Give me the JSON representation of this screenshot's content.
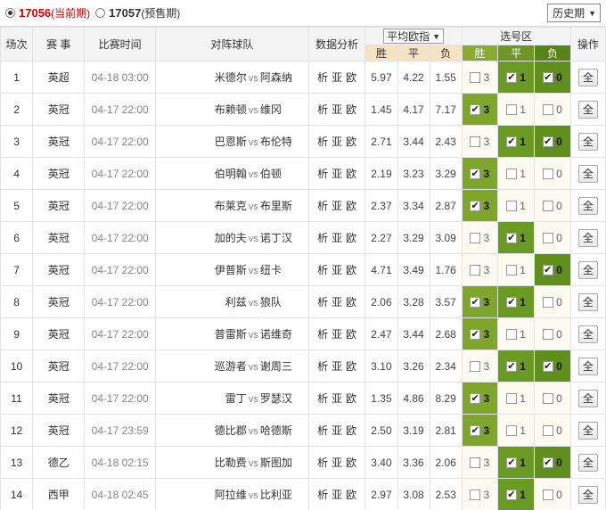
{
  "topbar": {
    "current": {
      "num": "17056",
      "note": "(当前期)"
    },
    "presale": {
      "num": "17057",
      "note": "(预售期)"
    },
    "history_label": "历史期"
  },
  "header": {
    "col_idx": "场次",
    "col_league": "赛 事",
    "col_time": "比赛时间",
    "col_teams": "对阵球队",
    "col_analysis": "数据分析",
    "odds_select": "平均欧指",
    "odds_w": "胜",
    "odds_d": "平",
    "odds_l": "负",
    "select_area": "选号区",
    "sel_w": "胜",
    "sel_d": "平",
    "sel_l": "负",
    "col_op": "操作"
  },
  "analysis_links": [
    "析",
    "亚",
    "欧"
  ],
  "vs": "vs",
  "all_label": "全",
  "rows": [
    {
      "idx": "1",
      "league": "英超",
      "time": "04-18 03:00",
      "home": "米德尔",
      "away": "阿森纳",
      "o": [
        "5.97",
        "4.22",
        "1.55"
      ],
      "p": [
        false,
        true,
        true
      ]
    },
    {
      "idx": "2",
      "league": "英冠",
      "time": "04-17 22:00",
      "home": "布赖顿",
      "away": "维冈",
      "o": [
        "1.45",
        "4.17",
        "7.17"
      ],
      "p": [
        true,
        false,
        false
      ]
    },
    {
      "idx": "3",
      "league": "英冠",
      "time": "04-17 22:00",
      "home": "巴恩斯",
      "away": "布伦特",
      "o": [
        "2.71",
        "3.44",
        "2.43"
      ],
      "p": [
        false,
        true,
        true
      ]
    },
    {
      "idx": "4",
      "league": "英冠",
      "time": "04-17 22:00",
      "home": "伯明翰",
      "away": "伯顿",
      "o": [
        "2.19",
        "3.23",
        "3.29"
      ],
      "p": [
        true,
        false,
        false
      ]
    },
    {
      "idx": "5",
      "league": "英冠",
      "time": "04-17 22:00",
      "home": "布莱克",
      "away": "布里斯",
      "o": [
        "2.37",
        "3.34",
        "2.87"
      ],
      "p": [
        true,
        false,
        false
      ]
    },
    {
      "idx": "6",
      "league": "英冠",
      "time": "04-17 22:00",
      "home": "加的夫",
      "away": "诺丁汉",
      "o": [
        "2.27",
        "3.29",
        "3.09"
      ],
      "p": [
        false,
        true,
        false
      ]
    },
    {
      "idx": "7",
      "league": "英冠",
      "time": "04-17 22:00",
      "home": "伊普斯",
      "away": "纽卡",
      "o": [
        "4.71",
        "3.49",
        "1.76"
      ],
      "p": [
        false,
        false,
        true
      ]
    },
    {
      "idx": "8",
      "league": "英冠",
      "time": "04-17 22:00",
      "home": "利兹",
      "away": "狼队",
      "o": [
        "2.06",
        "3.28",
        "3.57"
      ],
      "p": [
        true,
        true,
        false
      ]
    },
    {
      "idx": "9",
      "league": "英冠",
      "time": "04-17 22:00",
      "home": "普雷斯",
      "away": "诺维奇",
      "o": [
        "2.47",
        "3.44",
        "2.68"
      ],
      "p": [
        true,
        false,
        false
      ]
    },
    {
      "idx": "10",
      "league": "英冠",
      "time": "04-17 22:00",
      "home": "巡游者",
      "away": "谢周三",
      "o": [
        "3.10",
        "3.26",
        "2.34"
      ],
      "p": [
        false,
        true,
        true
      ]
    },
    {
      "idx": "11",
      "league": "英冠",
      "time": "04-17 22:00",
      "home": "雷丁",
      "away": "罗瑟汉",
      "o": [
        "1.35",
        "4.86",
        "8.29"
      ],
      "p": [
        true,
        false,
        false
      ]
    },
    {
      "idx": "12",
      "league": "英冠",
      "time": "04-17 23:59",
      "home": "德比郡",
      "away": "哈德斯",
      "o": [
        "2.50",
        "3.19",
        "2.81"
      ],
      "p": [
        true,
        false,
        false
      ]
    },
    {
      "idx": "13",
      "league": "德乙",
      "time": "04-18 02:15",
      "home": "比勒费",
      "away": "斯图加",
      "o": [
        "3.40",
        "3.36",
        "2.06"
      ],
      "p": [
        false,
        true,
        true
      ]
    },
    {
      "idx": "14",
      "league": "西甲",
      "time": "04-18 02:45",
      "home": "阿拉维",
      "away": "比利亚",
      "o": [
        "2.97",
        "3.08",
        "2.53"
      ],
      "p": [
        false,
        true,
        false
      ]
    }
  ],
  "pick_labels": [
    "3",
    "1",
    "0"
  ]
}
